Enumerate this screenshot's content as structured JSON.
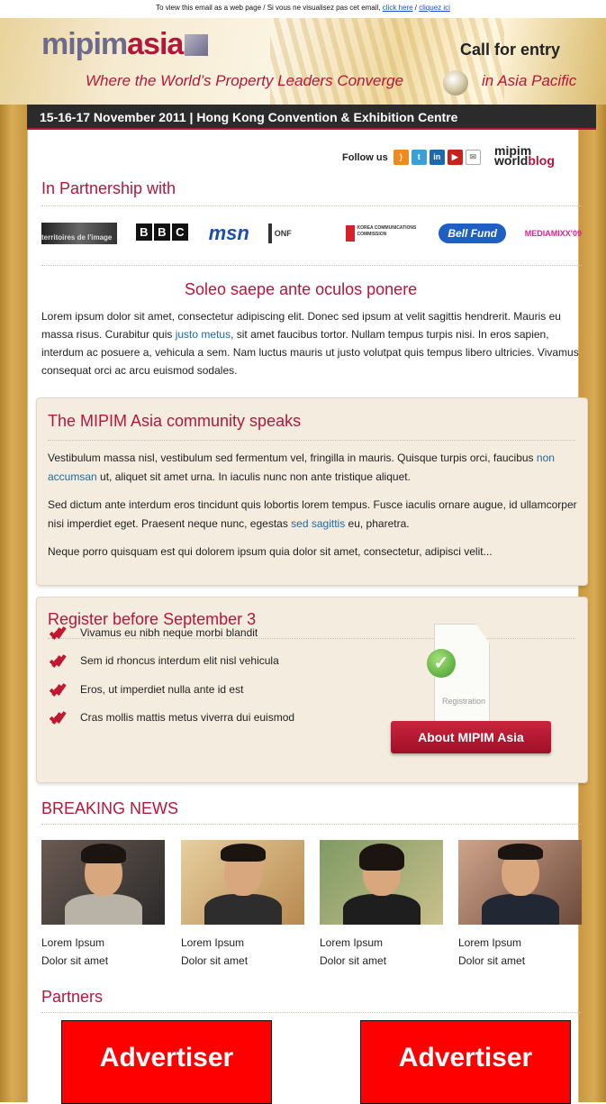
{
  "top_note": {
    "text": "To view this email as a web page / Si vous ne visualisez pas cet email,",
    "link1": "click here",
    "sep": " / ",
    "link2": "cliquez ici"
  },
  "header": {
    "logo_part1": "mipim",
    "logo_part2": "asia",
    "tagline": "Where the World’s Property Leaders Converge",
    "call": "Call for entry",
    "region": "in Asia Pacific"
  },
  "datebar": "15-16-17 November 2011 | Hong Kong Convention & Exhibition Centre",
  "follow": {
    "label": "Follow us",
    "icons": [
      "rss-icon",
      "twitter-icon",
      "linkedin-icon",
      "youtube-icon",
      "mail-icon"
    ],
    "blog_line1": "mipim",
    "blog_line2a": "world",
    "blog_line2b": "blog"
  },
  "partnership": {
    "title": "In Partnership with",
    "logos": [
      "territoires de l'image",
      "BBC",
      "msn",
      "ONF",
      "KOREA COMMUNICATIONS COMMISSION",
      "Bell Fund",
      "MEDIAMIXX'09"
    ]
  },
  "lead": {
    "title": "Soleo saepe ante oculos ponere",
    "p_before": "Lorem ipsum dolor sit amet, consectetur adipiscing elit. Donec sed ipsum at velit sagittis hendrerit. Mauris eu massa risus. Curabitur quis ",
    "p_link": "justo metus",
    "p_after": ", sit amet faucibus tortor. Nullam tempus turpis nisi. In eros sapien, interdum ac posuere a, vehicula a sem. Nam luctus mauris ut justo volutpat quis tempus libero ultricies. Vivamus consequat orci ac arcu euismod sodales."
  },
  "community": {
    "title": "The MIPIM Asia community speaks",
    "p1_before": "Vestibulum massa nisl, vestibulum sed fermentum vel, fringilla in mauris. Quisque turpis orci, faucibus ",
    "p1_link": "non accumsan",
    "p1_after": " ut, aliquet sit amet urna. In iaculis nunc non ante tristique aliquet.",
    "p2_before": "Sed dictum ante interdum eros tincidunt quis lobortis lorem tempus. Fusce iaculis ornare augue, id ullamcorper nisi imperdiet eget. Praesent neque nunc, egestas ",
    "p2_link": "sed sagittis",
    "p2_after": " eu, pharetra.",
    "p3": "Neque porro quisquam est qui dolorem ipsum quia dolor sit amet, consectetur, adipisci velit..."
  },
  "register": {
    "title": "Register before September 3",
    "items": [
      "Vivamus eu nibh neque morbi blandit",
      "Sem id rhoncus interdum elit nisl vehicula",
      "Eros, ut imperdiet nulla ante id est",
      "Cras mollis mattis metus viverra dui euismod"
    ],
    "doc_label": "Registration",
    "button": "About MIPIM Asia"
  },
  "news": {
    "title": "BREAKING NEWS",
    "items": [
      {
        "line1": "Lorem Ipsum",
        "line2": "Dolor sit amet"
      },
      {
        "line1": "Lorem Ipsum",
        "line2": "Dolor sit amet"
      },
      {
        "line1": "Lorem Ipsum",
        "line2": "Dolor sit amet"
      },
      {
        "line1": "Lorem Ipsum",
        "line2": "Dolor sit amet"
      }
    ]
  },
  "partners": {
    "title": "Partners",
    "ads": [
      "Advertiser",
      "Advertiser"
    ]
  },
  "colors": {
    "accent": "#b5173a",
    "panel": "#f3ecdf",
    "gold": "#c8963e",
    "link": "#1a6aa6",
    "ad": "#ff0000"
  }
}
